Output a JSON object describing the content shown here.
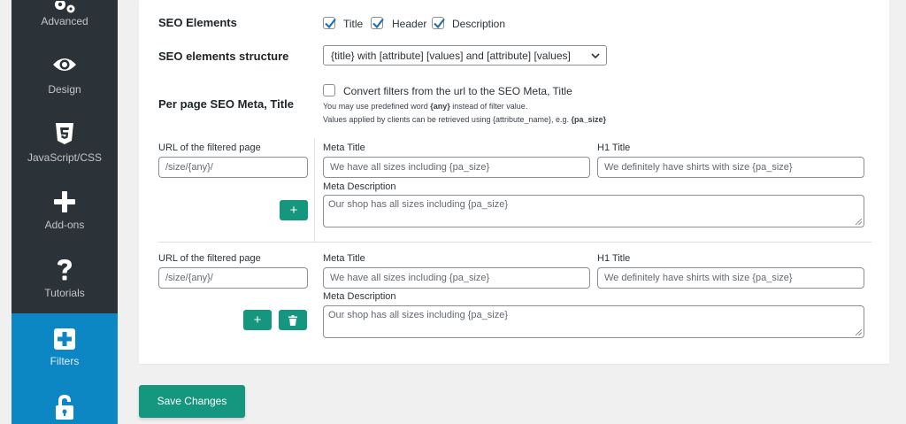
{
  "sidebar": {
    "items": [
      {
        "label": "Advanced",
        "icon": "gears-icon",
        "active": false
      },
      {
        "label": "Design",
        "icon": "eye-icon",
        "active": false
      },
      {
        "label": "JavaScript/CSS",
        "icon": "css3-icon",
        "active": false
      },
      {
        "label": "Add-ons",
        "icon": "plus-icon",
        "active": false
      },
      {
        "label": "Tutorials",
        "icon": "question-icon",
        "active": false
      },
      {
        "label": "Filters",
        "icon": "plus-square-icon",
        "active": true
      },
      {
        "label": "",
        "icon": "lock-open-icon",
        "active": false
      }
    ]
  },
  "seo_elements": {
    "label": "SEO Elements",
    "options": [
      {
        "label": "Title",
        "checked": true
      },
      {
        "label": "Header",
        "checked": true
      },
      {
        "label": "Description",
        "checked": true
      }
    ]
  },
  "seo_structure": {
    "label": "SEO elements structure",
    "selected": "{title} with [attribute] [values] and [attribute] [values]"
  },
  "per_page": {
    "label": "Per page SEO Meta, Title",
    "convert_label": "Convert filters from the url to the SEO Meta, Title",
    "convert_checked": false,
    "help1_pre": "You may use predefined word ",
    "help1_bold": "{any}",
    "help1_post": " instead of filter value.",
    "help2_pre": "Values applied by clients can be retrieved using {attribute_name}, e.g. ",
    "help2_bold": "{pa_size}"
  },
  "rules": [
    {
      "url_label": "URL of the filtered page",
      "url_value": "/size/{any}/",
      "meta_title_label": "Meta Title",
      "meta_title_value": "We have all sizes including {pa_size}",
      "h1_label": "H1 Title",
      "h1_value": "We definitely have shirts with size {pa_size}",
      "meta_desc_label": "Meta Description",
      "meta_desc_value": "Our shop has all sizes including {pa_size}",
      "add_label": "+"
    },
    {
      "url_label": "URL of the filtered page",
      "url_value": "/size/{any}/",
      "meta_title_label": "Meta Title",
      "meta_title_value": "We have all sizes including {pa_size}",
      "h1_label": "H1 Title",
      "h1_value": "We definitely have shirts with size {pa_size}",
      "meta_desc_label": "Meta Description",
      "meta_desc_value": "Our shop has all sizes including {pa_size}",
      "add_label": "+"
    }
  ],
  "save_label": "Save Changes",
  "colors": {
    "sidebar_bg": "#2c3338",
    "sidebar_active": "#0c87c4",
    "accent_green": "#15967e",
    "checkbox_blue": "#2271b1"
  }
}
